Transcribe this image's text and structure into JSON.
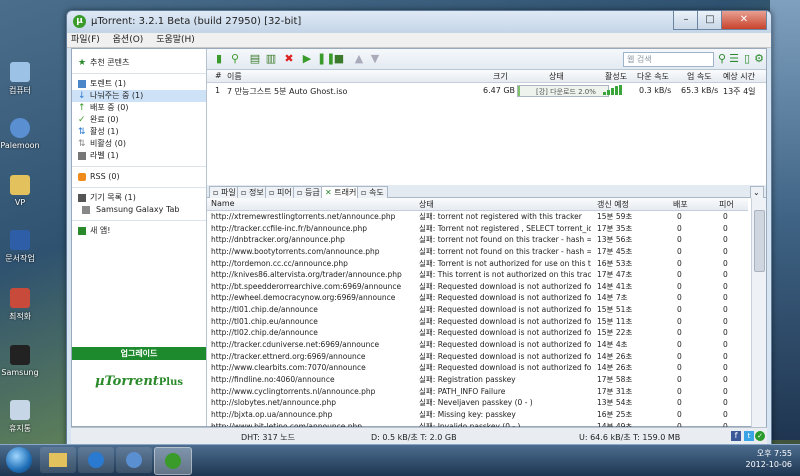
{
  "window": {
    "title": "µTorrent: 3.2.1 Beta (build 27950) [32-bit]"
  },
  "menu": [
    "파일(F)",
    "옵션(O)",
    "도움말(H)"
  ],
  "desktop_icons": [
    "컴퓨터",
    "Palemoon",
    "VP",
    "문서작업",
    "최적화",
    "Samsung",
    "휴지통"
  ],
  "sidebar": {
    "featured": "추천 콘텐츠",
    "torrents": "토렌트 (1)",
    "items": [
      "나눠주는 중 (1)",
      "배포 중 (0)",
      "완료 (0)",
      "활성 (1)",
      "비활성 (0)",
      "라벨 (1)"
    ],
    "rss": "RSS (0)",
    "devices": "기기 목록 (1)",
    "device_name": "Samsung Galaxy Tab",
    "new": "새 앱!",
    "upgrade": "업그레이드",
    "plus_brand": "µTorrent",
    "plus_suffix": "Plus"
  },
  "search": {
    "placeholder": "웹 검색"
  },
  "torrent_table": {
    "headers": {
      "num": "#",
      "name": "이름",
      "size": "크기",
      "status": "상태",
      "health": "활성도",
      "down": "다운 속도",
      "up": "업 속도",
      "eta": "예상 시간"
    },
    "row": {
      "num": "1",
      "name": "7 만능그스트 5분 Auto Ghost.iso",
      "size": "6.47 GB",
      "status": "[강] 다운로드 2.0%",
      "progress": 0.02,
      "down": "0.3 kB/s",
      "up": "65.3 kB/s",
      "eta": "13주 4일"
    }
  },
  "tabs": [
    "파일",
    "정보",
    "피어",
    "등급",
    "트래커",
    "속도"
  ],
  "tracker_table": {
    "headers": {
      "name": "Name",
      "status": "상태",
      "update": "갱신 예정",
      "seeds": "배포",
      "peers": "피어"
    },
    "rows": [
      {
        "name": "http://xtremewrestlingtorrents.net/announce.php",
        "status": "실패: torrent not registered with this tracker",
        "update": "15분 59초",
        "seeds": "0",
        "peers": "0"
      },
      {
        "name": "http://tracker.ccfile-inc.fr/b/announce.php",
        "status": "실패: Torrent not registered , SELECT torrent_id, size...",
        "update": "17분 35초",
        "seeds": "0",
        "peers": "0"
      },
      {
        "name": "http://dnbtracker.org/announce.php",
        "status": "실패: torrent not found on this tracker - hash = f648...",
        "update": "13분 56초",
        "seeds": "0",
        "peers": "0"
      },
      {
        "name": "http://www.bootytorrents.com/announce.php",
        "status": "실패: torrent not found on this tracker - hash = f648...",
        "update": "17분 45초",
        "seeds": "0",
        "peers": "0"
      },
      {
        "name": "http://tordemon.cc.cc/announce.php",
        "status": "실패: Torrent is not authorized for use on this tracker.",
        "update": "16분 53초",
        "seeds": "0",
        "peers": "0"
      },
      {
        "name": "http://knives86.altervista.org/trader/announce.php",
        "status": "실패: This torrent is not authorized on this tracker",
        "update": "17분 47초",
        "seeds": "0",
        "peers": "0"
      },
      {
        "name": "http://bt.speedderorrearchive.com:6969/announce",
        "status": "실패: Requested download is not authorized for use ...",
        "update": "14분 41초",
        "seeds": "0",
        "peers": "0"
      },
      {
        "name": "http://ewheel.democracynow.org:6969/announce",
        "status": "실패: Requested download is not authorized for use ...",
        "update": "14분 7초",
        "seeds": "0",
        "peers": "0"
      },
      {
        "name": "http://tl01.chip.de/announce",
        "status": "실패: Requested download is not authorized for use ...",
        "update": "15분 51초",
        "seeds": "0",
        "peers": "0"
      },
      {
        "name": "http://tl01.chip.eu/announce",
        "status": "실패: Requested download is not authorized for use ...",
        "update": "15분 11초",
        "seeds": "0",
        "peers": "0"
      },
      {
        "name": "http://tl02.chip.de/announce",
        "status": "실패: Requested download is not authorized for use ...",
        "update": "15분 22초",
        "seeds": "0",
        "peers": "0"
      },
      {
        "name": "http://tracker.cduniverse.net:6969/announce",
        "status": "실패: Requested download is not authorized for use ...",
        "update": "14분 4초",
        "seeds": "0",
        "peers": "0"
      },
      {
        "name": "http://tracker.ettnerd.org:6969/announce",
        "status": "실패: Requested download is not authorized for use ...",
        "update": "14분 26초",
        "seeds": "0",
        "peers": "0"
      },
      {
        "name": "http://www.clearbits.com:7070/announce",
        "status": "실패: Requested download is not authorized for use ...",
        "update": "14분 26초",
        "seeds": "0",
        "peers": "0"
      },
      {
        "name": "http://findline.no:4060/announce",
        "status": "실패: Registration passkey",
        "update": "17분 58초",
        "seeds": "0",
        "peers": "0"
      },
      {
        "name": "http://www.cyclingtorrents.nl/announce.php",
        "status": "실패: PATH_INFO Failure",
        "update": "17분 31초",
        "seeds": "0",
        "peers": "0"
      },
      {
        "name": "http://slobytes.net/announce.php",
        "status": "실패: Neveljaven passkey (0 - )",
        "update": "13분 54초",
        "seeds": "0",
        "peers": "0"
      },
      {
        "name": "http://bjxta.op.ua/announce.php",
        "status": "실패: Missing key: passkey",
        "update": "16분 25초",
        "seeds": "0",
        "peers": "0"
      },
      {
        "name": "http://www.bit-letino.com/announce.php",
        "status": "실패: Invalido passkey (0 - )",
        "update": "14분 49초",
        "seeds": "0",
        "peers": "0"
      },
      {
        "name": "http://www.learnbits.me/announce.php",
        "status": "실패: Invalid Passkey!",
        "update": "15분 56초",
        "seeds": "0",
        "peers": "0"
      },
      {
        "name": "http://chronictracker.com/announce.php",
        "status": "실패: Invalid passkey (0 - ) - Please redownload the to...",
        "update": "17분 52초",
        "seeds": "0",
        "peers": "0"
      }
    ]
  },
  "status_bar": {
    "dht": "DHT: 317 노드",
    "down": "D: 0.5 kB/초 T: 2.0 GB",
    "up": "U: 64.6 kB/초 T: 159.0 MB"
  },
  "clock": {
    "time": "오후 7:55",
    "date": "2012-10-06"
  }
}
